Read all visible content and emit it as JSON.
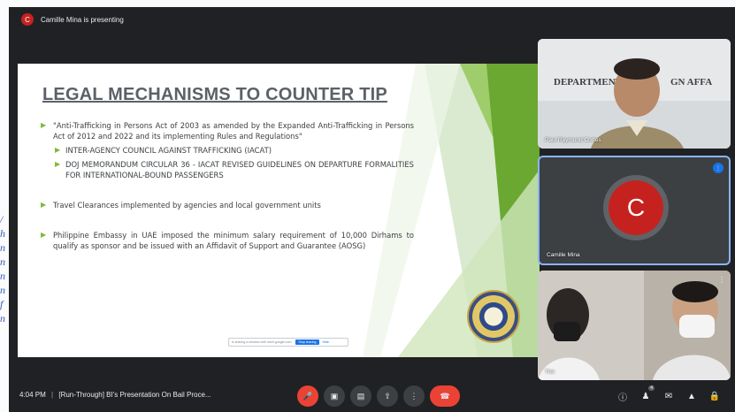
{
  "presenter": {
    "avatar_letter": "C",
    "banner": "Camille Mina is presenting"
  },
  "slide": {
    "title": "LEGAL MECHANISMS TO COUNTER TIP",
    "bullets": [
      {
        "level": 1,
        "text": "\"Anti-Trafficking in Persons Act of 2003 as amended by the Expanded Anti-Trafficking in Persons Act of 2012 and 2022 and its implementing Rules and Regulations\""
      },
      {
        "level": 2,
        "text": "INTER-AGENCY COUNCIL AGAINST TRAFFICKING (IACAT)"
      },
      {
        "level": 2,
        "text": "DOJ MEMORANDUM CIRCULAR 36 - IACAT REVISED GUIDELINES ON DEPARTURE FORMALITIES FOR INTERNATIONAL-BOUND PASSENGERS"
      },
      {
        "level": 1,
        "text": "Travel Clearances implemented by agencies and local government units"
      },
      {
        "level": 1,
        "text": "Philippine Embassy in UAE imposed the minimum salary requirement of 10,000 Dirhams to qualify as sponsor and be issued with an Affidavit of Support and Guarantee (AOSG)"
      }
    ],
    "share_bar": {
      "text": "is sharing a window with meet.google.com.",
      "stop_label": "Stop sharing",
      "hide_label": "Hide"
    }
  },
  "participants": {
    "tile1": {
      "name": "Paul Raymund Cortes",
      "backdrop": "DEPARTMENT OF FOREIGN AFFAIRS"
    },
    "tile2": {
      "name": "Camille Mina",
      "letter": "C"
    },
    "tile3": {
      "name": "You"
    }
  },
  "bottombar": {
    "time": "4:04 PM",
    "separator": "|",
    "meeting_title": "[Run-Through] BI's Presentation On Bail Proce...",
    "people_count": "4"
  },
  "colors": {
    "accent_green": "#7dbb3a",
    "end_call": "#ea4335",
    "meet_dark": "#202124"
  }
}
